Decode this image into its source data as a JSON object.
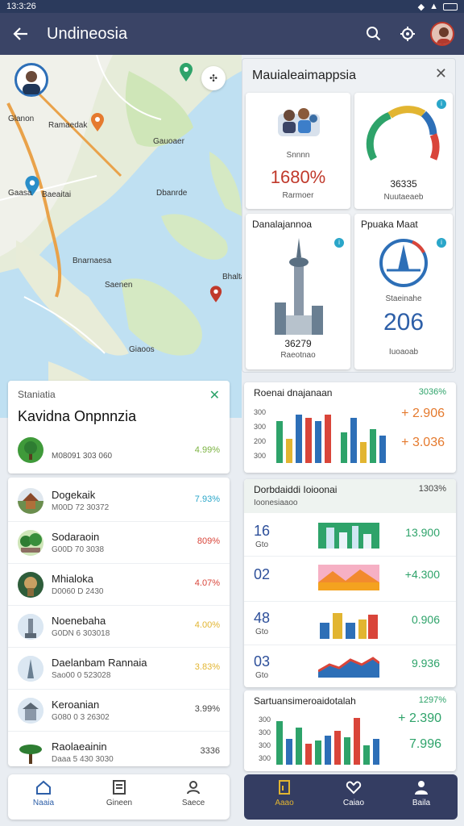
{
  "status_bar": {
    "time": "13:3:26",
    "icons": "N",
    "battery": ""
  },
  "app_bar": {
    "title": "Undineosia"
  },
  "map": {
    "labels": [
      "Glanon",
      "Ramaedak",
      "Gauoaer",
      "Baeaitai",
      "Gaasa",
      "Dbanrde",
      "Bnarnaesa",
      "Bhaltan",
      "Saenen",
      "Giaoos"
    ]
  },
  "info_panel": {
    "title": "Mauialeaimappsia",
    "cards": [
      {
        "caption": "Snnnn",
        "value": "1680%",
        "label": "Rarmoer"
      },
      {
        "caption": "",
        "value": "36335",
        "label": "Nuutaeaeb"
      },
      {
        "caption": "Danalajannoa",
        "value": "36279",
        "label": "Raeotnao"
      },
      {
        "caption": "Ppuaka Maat",
        "value": "206",
        "label": "Iuoaoab",
        "sub": "Staeinahe"
      }
    ]
  },
  "chart_card_1": {
    "title": "Roenai dnajanaan",
    "pct": "3036%",
    "stat1": "+ 2.906",
    "stat2": "+ 3.036",
    "ticks": [
      "300",
      "300",
      "200",
      "300"
    ]
  },
  "table_card": {
    "title": "Dorbdaiddi Ioioonai",
    "subtitle": "Ioonesiaaoo",
    "pct": "1303%",
    "rows": [
      {
        "num": "16",
        "sub": "Gto",
        "value": "13.900"
      },
      {
        "num": "02",
        "sub": "",
        "value": "+4.300"
      },
      {
        "num": "48",
        "sub": "Gto",
        "value": "0.906"
      },
      {
        "num": "03",
        "sub": "Gto",
        "value": "9.936"
      }
    ]
  },
  "chart_card_2": {
    "title": "Sartuansimeroaidotalah",
    "pct": "1297%",
    "stat1": "+ 2.390",
    "stat2": "7.996",
    "ticks": [
      "300",
      "300",
      "300",
      "300"
    ]
  },
  "summary_card": {
    "label": "Staniatia",
    "title": "Kavidna Onpnnzia",
    "row_code": "M08091 303 060",
    "row_value": "4.99%"
  },
  "places": [
    {
      "name": "Dogekaik",
      "code": "M00D 72 30372",
      "value": "7.93%",
      "color": "#2aa6c9"
    },
    {
      "name": "Sodaraoin",
      "code": "G00D 70 3038",
      "value": "809%",
      "color": "#d9453a"
    },
    {
      "name": "Mhialoka",
      "code": "D0060 D 2430",
      "value": "4.07%",
      "color": "#d9453a"
    },
    {
      "name": "Noenebaha",
      "code": "G0DN 6 303018",
      "value": "4.00%",
      "color": "#e2b531"
    },
    {
      "name": "Daelanbam Rannaia",
      "code": "Sao00 0 523028",
      "value": "3.83%",
      "color": "#e2b531"
    },
    {
      "name": "Keroanian",
      "code": "G080 0 3 26302",
      "value": "3.99%",
      "color": "#444"
    },
    {
      "name": "Raolaeainin",
      "code": "Daaa 5 430 3030",
      "value": "3336",
      "color": "#444"
    }
  ],
  "nav_left": [
    {
      "label": "Naaia"
    },
    {
      "label": "Gineen"
    },
    {
      "label": "Saece"
    }
  ],
  "nav_right": [
    {
      "label": "Aaao"
    },
    {
      "label": "Caiao"
    },
    {
      "label": "Baila"
    }
  ]
}
